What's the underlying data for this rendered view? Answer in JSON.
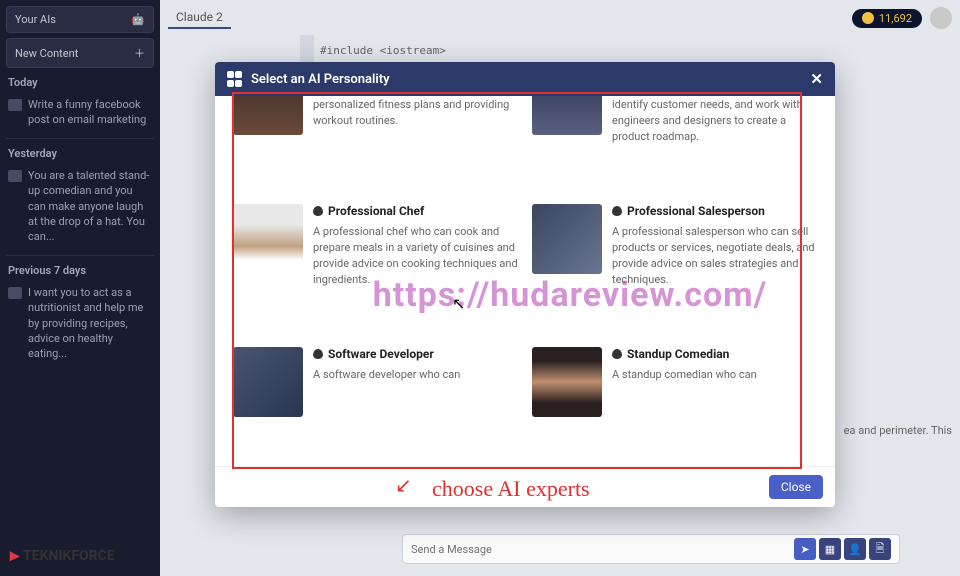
{
  "sidebar": {
    "your_ais": "Your AIs",
    "new_content": "New Content",
    "sections": {
      "today": "Today",
      "yesterday": "Yesterday",
      "prev7": "Previous 7 days"
    },
    "items": {
      "today1": "Write a funny facebook post on email marketing",
      "yest1": "You are a talented stand-up comedian and you can make anyone laugh at the drop of a hat. You can...",
      "prev1": "I want you to act as a nutritionist and help me by providing recipes, advice on healthy eating..."
    }
  },
  "brand": "TEKNIKFORCE",
  "tab": "Claude 2",
  "coins": "11,692",
  "code": "#include <iostream>",
  "msg_hint": "ea and perimeter. This",
  "chat_placeholder": "Send a Message",
  "modal": {
    "title": "Select an AI Personality",
    "close_btn": "Close",
    "cards": [
      {
        "title": "",
        "desc": "A personal trainer who can help you stay fit and improve your health by creating personalized fitness plans and providing workout routines."
      },
      {
        "title": "",
        "desc": "A product manager who can oversee the development and marketing of a product, identify customer needs, and work with engineers and designers to create a product roadmap."
      },
      {
        "title": "Professional Chef",
        "desc": "A professional chef who can cook and prepare meals in a variety of cuisines and provide advice on cooking techniques and ingredients."
      },
      {
        "title": "Professional Salesperson",
        "desc": "A professional salesperson who can sell products or services, negotiate deals, and provide advice on sales strategies and techniques."
      },
      {
        "title": "Software Developer",
        "desc": "A software developer who can"
      },
      {
        "title": "Standup Comedian",
        "desc": "A standup comedian who can"
      }
    ]
  },
  "annotation": "choose AI experts",
  "watermark": "https://hudareview.com/"
}
